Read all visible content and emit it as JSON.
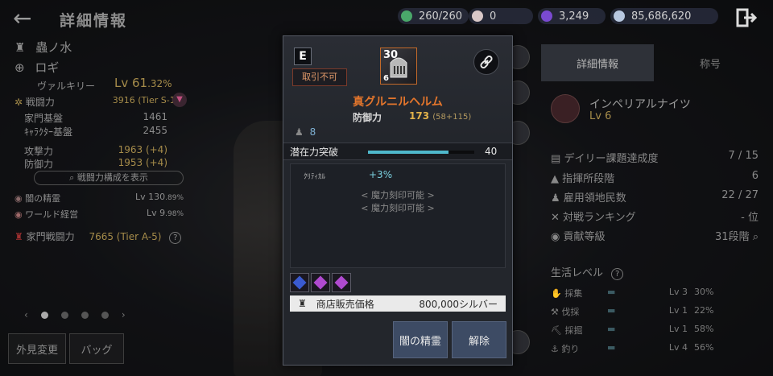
{
  "header": {
    "title": "詳細情報",
    "resources": [
      {
        "icon": "energy-icon",
        "value": "260/260",
        "color": "#4aa86a"
      },
      {
        "icon": "pearl-icon",
        "value": "0",
        "color": "#d9c8c8"
      },
      {
        "icon": "purple-orb-icon",
        "value": "3,249",
        "color": "#7a4ad0"
      },
      {
        "icon": "silver-coin-icon",
        "value": "85,686,620",
        "color": "#b8c8e0"
      }
    ]
  },
  "left": {
    "char_name": "蟲ノ水",
    "family_name": "ロギ",
    "class": "ヴァルキリー",
    "level": "Lv 61",
    "level_pct": ".32%",
    "rows": [
      {
        "label": "戦闘力",
        "value": "3916 (Tier S-1)"
      },
      {
        "label": "家門基盤",
        "value": "1461"
      },
      {
        "label": "ｷｬﾗｸﾀｰ基盤",
        "value": "2455"
      },
      {
        "label": "攻撃力",
        "value": "1963 (+4)"
      },
      {
        "label": "防御力",
        "value": "1953 (+4)"
      }
    ],
    "cp_button": "戦闘力構成を表示",
    "spirit": {
      "label": "闇の精霊",
      "value": "Lv 130",
      "pct": ".89%"
    },
    "world": {
      "label": "ワールド経営",
      "value": "Lv 9",
      "pct": ".98%"
    },
    "family_cp": {
      "label": "家門戦闘力",
      "value": "7665 (Tier A-5)"
    },
    "buttons": [
      "外見変更",
      "バッグ"
    ],
    "help": "?"
  },
  "right": {
    "tabs": [
      "詳細情報",
      "称号"
    ],
    "guild": {
      "name": "インペリアルナイツ",
      "level": "Lv 6"
    },
    "stats": [
      {
        "icon": "quest-icon",
        "label": "デイリー課題達成度",
        "value": "7 / 15"
      },
      {
        "icon": "command-icon",
        "label": "指揮所段階",
        "value": "6"
      },
      {
        "icon": "worker-icon",
        "label": "雇用領地民数",
        "value": "22 / 27"
      },
      {
        "icon": "swords-icon",
        "label": "対戦ランキング",
        "value": "- 位"
      },
      {
        "icon": "contribution-icon",
        "label": "貢献等級",
        "value": "31段階"
      }
    ],
    "life_title": "生活レベル",
    "life": [
      {
        "label": "採集",
        "lv": "Lv 3",
        "pct": "30%"
      },
      {
        "label": "伐採",
        "lv": "Lv 1",
        "pct": "22%"
      },
      {
        "label": "採掘",
        "lv": "Lv 1",
        "pct": "58%"
      },
      {
        "label": "釣り",
        "lv": "Lv 4",
        "pct": "56%"
      }
    ]
  },
  "popup": {
    "grade": "E",
    "untradable": "取引不可",
    "item_level": "30",
    "item_sub": "6",
    "item_name": "真グルニルヘルム",
    "defense_label": "防御力",
    "defense_value": "173",
    "defense_detail": "(58+115)",
    "weight": "8",
    "potential_label": "潜在力突破",
    "potential_value": "40",
    "potential_fraction": 0.76,
    "option_label": "ｸﾘﾃｨｶﾙ",
    "option_value": "+3%",
    "magic_slots": [
      "< 魔力刻印可能 >",
      "< 魔力刻印可能 >"
    ],
    "price_label": "商店販売価格",
    "price_value": "800,000シルバー",
    "buttons": {
      "spirit": "闇の精霊",
      "release": "解除"
    }
  }
}
